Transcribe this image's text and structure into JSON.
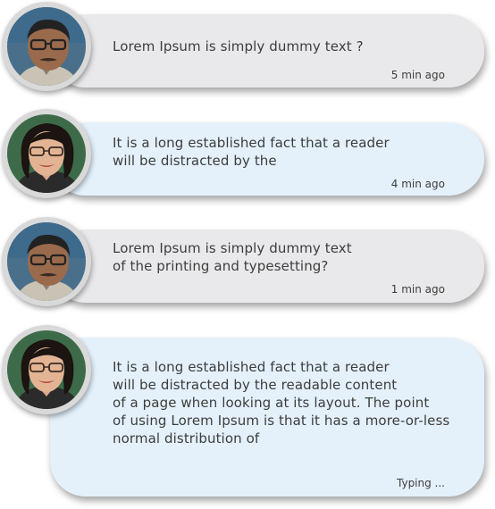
{
  "messages": [
    {
      "sender": "man",
      "text": "Lorem Ipsum is simply dummy text ?",
      "time": "5 min ago"
    },
    {
      "sender": "woman",
      "text": "It is a long established fact that a reader\nwill be distracted by the",
      "time": "4 min ago"
    },
    {
      "sender": "man",
      "text": "Lorem Ipsum is simply dummy text\nof the printing and typesetting?",
      "time": "1 min ago"
    },
    {
      "sender": "woman",
      "text": "It is a long established fact that a reader\nwill be distracted by the readable content\nof a page when looking at its layout. The point\nof using Lorem Ipsum is that it has a more-or-less\nnormal distribution of",
      "time": "Typing ..."
    }
  ],
  "colors": {
    "grey_bubble": "#e9e9eb",
    "blue_bubble": "#e4f1fb",
    "avatar_ring": "#d9d9d9",
    "text": "#3d3d3d"
  }
}
